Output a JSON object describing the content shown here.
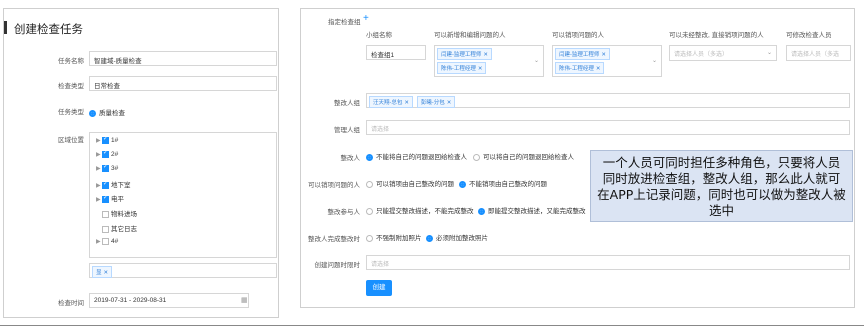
{
  "left": {
    "title": "创建检查任务",
    "task_name_label": "任务名称",
    "task_name_value": "智建域-质量检查",
    "check_type_label": "检查类型",
    "check_type_value": "日常检查",
    "task_type_label": "任务类型",
    "task_type_option": "质量检查",
    "area_label": "区域位置",
    "tree": [
      "1#",
      "2#",
      "3#",
      "地下室",
      "电平",
      "物料进场",
      "其它日志",
      "4#"
    ],
    "selected_tag": "显",
    "time_label": "检查时间",
    "time_value": "2019-07-31 - 2029-08-31"
  },
  "right": {
    "assign_group_label": "指定检查组",
    "add_icon": "+",
    "col_headers": [
      "小组名称",
      "可以新增和编辑问题的人",
      "可以销项问题的人",
      "可以未经整改, 直接销项问题的人",
      "可修改检查人员"
    ],
    "group_name_value": "检查组1",
    "editors_tags": [
      "闫建-监理工程师",
      "陈伟-工程经理"
    ],
    "closers_tags": [
      "闫建-监理工程师",
      "陈伟-工程经理"
    ],
    "direct_close_placeholder": "请选择人员（多选）",
    "modify_placeholder": "请选择人员（多选",
    "rectify_person_label": "整改人组",
    "rectify_person_tags": [
      "汪天翔-总包",
      "彭曦-分包"
    ],
    "manager_label": "管理人组",
    "manager_placeholder": "请选择",
    "rectify_label": "整改人",
    "rectify_opt1": "不能将自己的问题退回给检查人",
    "rectify_opt2": "可以将自己的问题退回给检查人",
    "closer_label": "可以销项问题的人",
    "closer_opt1": "可以销项由自己整改的问题",
    "closer_opt2": "不能销项由自己整改的问题",
    "participant_label": "整改参与人",
    "participant_opt1": "只能提交整改描述，不能完成整改",
    "participant_opt2": "即能提交整改描述，又能完成整改",
    "complete_label": "整改人完成整改时",
    "complete_opt1": "不强制附加照片",
    "complete_opt2": "必须附加整改照片",
    "create_time_label": "创建问题时限时",
    "create_time_placeholder": "请选择",
    "create_button": "创建"
  },
  "callout_text": "一个人员可同时担任多种角色，只要将人员同时放进检查组，整改人组，那么此人就可在APP上记录问题，同时也可以做为整改人被选中"
}
